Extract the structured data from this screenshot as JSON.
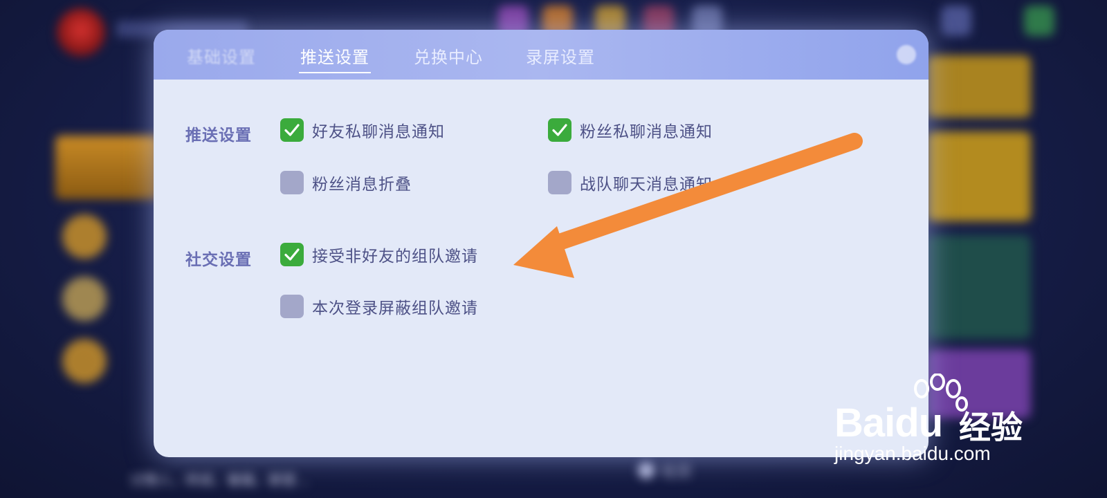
{
  "background": {
    "bottom_text": "讨情人，终成，眷属。群里…",
    "social_label": "社交"
  },
  "dialog": {
    "tabs": [
      {
        "label": "基础设置",
        "state": "inactive"
      },
      {
        "label": "推送设置",
        "state": "active"
      },
      {
        "label": "兑换中心",
        "state": "inactive"
      },
      {
        "label": "录屏设置",
        "state": "inactive"
      }
    ],
    "push_section": {
      "title": "推送设置",
      "options": [
        {
          "label": "好友私聊消息通知",
          "checked": true
        },
        {
          "label": "粉丝私聊消息通知",
          "checked": true
        },
        {
          "label": "粉丝消息折叠",
          "checked": false
        },
        {
          "label": "战队聊天消息通知",
          "checked": false
        }
      ]
    },
    "social_section": {
      "title": "社交设置",
      "options": [
        {
          "label": "接受非好友的组队邀请",
          "checked": true
        },
        {
          "label": "本次登录屏蔽组队邀请",
          "checked": false
        }
      ]
    }
  },
  "annotation": {
    "arrow_color": "#f38b3a"
  },
  "watermark": {
    "brand": "Bai",
    "brand_du": "du",
    "suffix": "经验",
    "url": "jingyan.baidu.com"
  },
  "colors": {
    "checkbox_on": "#3bab3c",
    "checkbox_off": "#a3a7c9",
    "header": "#9aa9ec",
    "panel": "#e3e9f8"
  }
}
